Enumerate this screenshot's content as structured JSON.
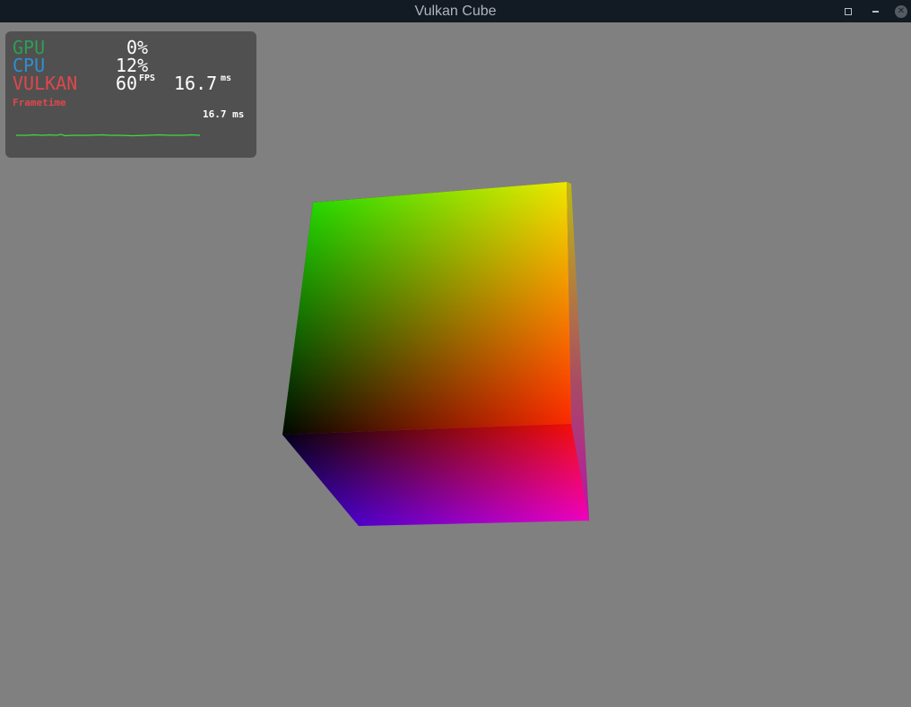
{
  "window": {
    "title": "Vulkan Cube",
    "controls": {
      "maximize_icon": "maximize-icon",
      "minimize_icon": "minimize-icon",
      "close_icon": "close-icon"
    }
  },
  "hud": {
    "gpu_label": "GPU",
    "gpu_value": "0%",
    "cpu_label": "CPU",
    "cpu_value": "12%",
    "api_label": "VULKAN",
    "fps_value": "60",
    "fps_unit": "FPS",
    "frametime_value": "16.7",
    "frametime_unit": "ms",
    "frametime_label": "Frametime",
    "frametime_graph_value": "16.7 ms",
    "colors": {
      "gpu": "#2e9e55",
      "cpu": "#2f8fd1",
      "api": "#e0474c",
      "graph": "#3fdc3f"
    }
  },
  "scene": {
    "background": "#808080",
    "cube_colors": {
      "front_top_left": "#00ff00",
      "front_top_right": "#ffff00",
      "front_bottom_left": "#000000",
      "front_bottom_right": "#ff0000",
      "bottom_left": "#0000ff",
      "bottom_right": "#ff00ff"
    }
  }
}
